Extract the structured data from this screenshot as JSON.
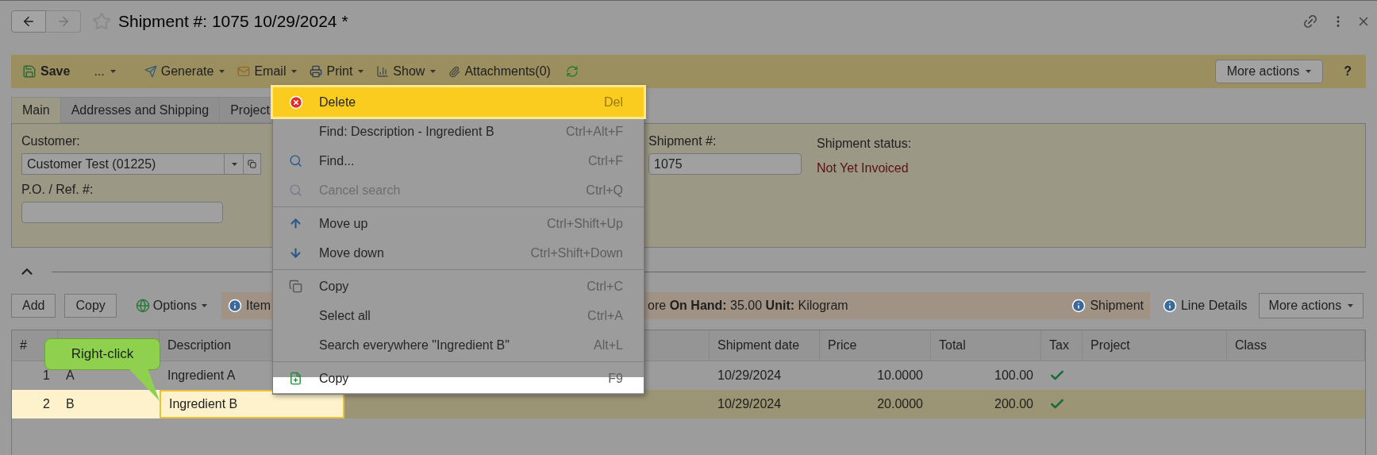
{
  "title": "Shipment #: 1075 10/29/2024 *",
  "toolbar": {
    "items": [
      {
        "kind": "save",
        "label": "Save",
        "dropdown": false
      },
      {
        "kind": "plain",
        "label": "...",
        "dropdown": true
      },
      {
        "kind": "generate",
        "label": "Generate",
        "dropdown": true
      },
      {
        "kind": "email",
        "label": "Email",
        "dropdown": true
      },
      {
        "kind": "print",
        "label": "Print",
        "dropdown": true
      },
      {
        "kind": "show",
        "label": "Show",
        "dropdown": true
      },
      {
        "kind": "attach",
        "label": "Attachments(0)",
        "dropdown": false
      }
    ],
    "more_actions": "More actions",
    "help": "?"
  },
  "tabs": [
    {
      "label": "Main",
      "selected": true
    },
    {
      "label": "Addresses and Shipping",
      "selected": false
    },
    {
      "label": "Project",
      "selected": false
    }
  ],
  "form": {
    "customer_label": "Customer:",
    "customer_value": "Customer Test (01225)",
    "po_label": "P.O. / Ref. #:",
    "shipment_label": "Shipment #:",
    "shipment_value": "1075",
    "status_label": "Shipment status:",
    "status_value": "Not Yet Invoiced"
  },
  "grid_toolbar": {
    "buttons": [
      {
        "kind": "button",
        "label": "Add"
      },
      {
        "kind": "button",
        "label": "Copy"
      },
      {
        "kind": "options",
        "label": "Options"
      }
    ],
    "info": {
      "item": "Item",
      "details": "ore **On Hand:** 35.00 **Unit:** Kilogram",
      "shipment": "Shipment"
    },
    "line_details": "Line Details",
    "more_actions": "More actions"
  },
  "grid": {
    "columns": {
      "number": "#",
      "description": "Description",
      "shipment_date": "Shipment date",
      "price": "Price",
      "total": "Total",
      "tax": "Tax",
      "project": "Project",
      "class": "Class"
    },
    "rows": [
      {
        "number": "1",
        "column_2": "A",
        "description": "Ingredient A",
        "shipment_date": "10/29/2024",
        "price": "10.0000",
        "total": "100.00",
        "tax": true,
        "selected": false
      },
      {
        "number": "2",
        "column_2": "B",
        "description": "Ingredient B",
        "shipment_date": "10/29/2024",
        "price": "20.0000",
        "total": "200.00",
        "tax": true,
        "selected": true
      }
    ]
  },
  "context_menu": {
    "groups": [
      [
        {
          "label": "Delete",
          "shortcut": "Del",
          "disabled": false,
          "highlighted": true
        },
        {
          "label": "Find: Description - Ingredient B",
          "shortcut": "Ctrl+Alt+F",
          "disabled": false,
          "highlighted": false
        },
        {
          "label": "Find...",
          "shortcut": "Ctrl+F",
          "disabled": false,
          "highlighted": false
        },
        {
          "label": "Cancel search",
          "shortcut": "Ctrl+Q",
          "disabled": true,
          "highlighted": false
        }
      ],
      [
        {
          "label": "Move up",
          "shortcut": "Ctrl+Shift+Up",
          "disabled": false,
          "highlighted": false
        },
        {
          "label": "Move down",
          "shortcut": "Ctrl+Shift+Down",
          "disabled": false,
          "highlighted": false
        }
      ],
      [
        {
          "label": "Copy",
          "shortcut": "Ctrl+C",
          "disabled": false,
          "highlighted": false
        },
        {
          "label": "Select all",
          "shortcut": "Ctrl+A",
          "disabled": false,
          "highlighted": false
        },
        {
          "label": "Search everywhere \"Ingredient B\"",
          "shortcut": "Alt+L",
          "disabled": false,
          "highlighted": false
        }
      ],
      [
        {
          "label": "Copy",
          "shortcut": "F9",
          "disabled": false,
          "highlighted": false
        }
      ]
    ]
  },
  "callout": "Right-click"
}
